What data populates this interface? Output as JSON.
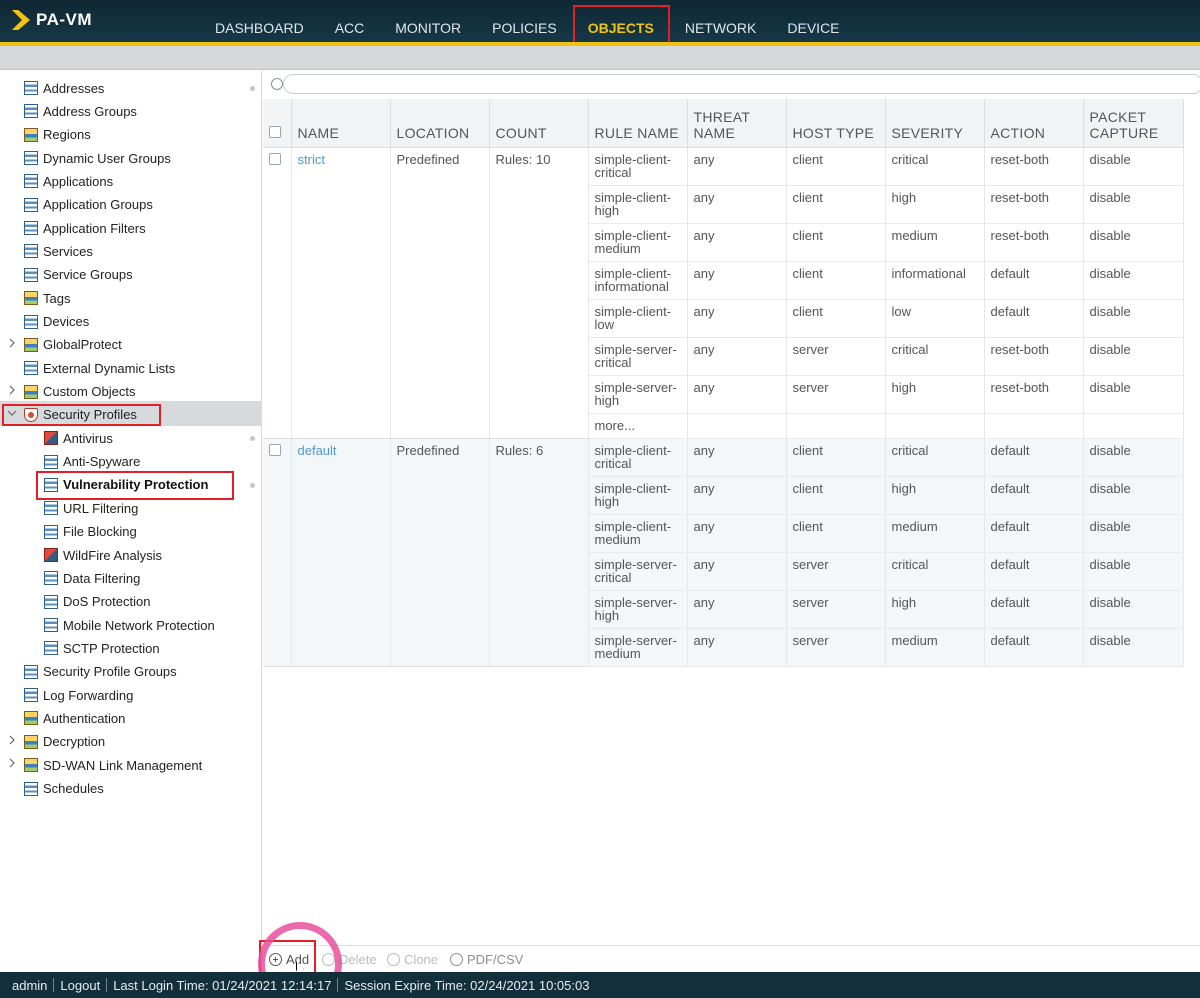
{
  "app": {
    "title": "PA-VM"
  },
  "nav": [
    "DASHBOARD",
    "ACC",
    "MONITOR",
    "POLICIES",
    "OBJECTS",
    "NETWORK",
    "DEVICE"
  ],
  "nav_active": "OBJECTS",
  "sidebar": {
    "items": [
      {
        "label": "Addresses",
        "icon": "address-icon"
      },
      {
        "label": "Address Groups",
        "icon": "address-group-icon"
      },
      {
        "label": "Regions",
        "icon": "region-icon"
      },
      {
        "label": "Dynamic User Groups",
        "icon": "user-group-icon"
      },
      {
        "label": "Applications",
        "icon": "application-icon"
      },
      {
        "label": "Application Groups",
        "icon": "application-group-icon"
      },
      {
        "label": "Application Filters",
        "icon": "application-filter-icon"
      },
      {
        "label": "Services",
        "icon": "service-icon"
      },
      {
        "label": "Service Groups",
        "icon": "service-group-icon"
      },
      {
        "label": "Tags",
        "icon": "tag-icon"
      },
      {
        "label": "Devices",
        "icon": "device-icon"
      },
      {
        "label": "GlobalProtect",
        "icon": "globalprotect-icon"
      },
      {
        "label": "External Dynamic Lists",
        "icon": "external-list-icon"
      },
      {
        "label": "Custom Objects",
        "icon": "custom-object-icon"
      },
      {
        "label": "Security Profiles",
        "icon": "security-profile-icon"
      },
      {
        "label": "Antivirus",
        "icon": "antivirus-icon"
      },
      {
        "label": "Anti-Spyware",
        "icon": "anti-spyware-icon"
      },
      {
        "label": "Vulnerability Protection",
        "icon": "vulnerability-icon"
      },
      {
        "label": "URL Filtering",
        "icon": "url-filter-icon"
      },
      {
        "label": "File Blocking",
        "icon": "file-blocking-icon"
      },
      {
        "label": "WildFire Analysis",
        "icon": "wildfire-icon"
      },
      {
        "label": "Data Filtering",
        "icon": "data-filter-icon"
      },
      {
        "label": "DoS Protection",
        "icon": "dos-icon"
      },
      {
        "label": "Mobile Network Protection",
        "icon": "mobile-network-icon"
      },
      {
        "label": "SCTP Protection",
        "icon": "sctp-icon"
      },
      {
        "label": "Security Profile Groups",
        "icon": "profile-group-icon"
      },
      {
        "label": "Log Forwarding",
        "icon": "log-forwarding-icon"
      },
      {
        "label": "Authentication",
        "icon": "authentication-icon"
      },
      {
        "label": "Decryption",
        "icon": "decryption-icon"
      },
      {
        "label": "SD-WAN Link Management",
        "icon": "sdwan-icon"
      },
      {
        "label": "Schedules",
        "icon": "schedule-icon"
      }
    ],
    "selected": "Vulnerability Protection"
  },
  "search": {
    "placeholder": "",
    "value": ""
  },
  "table": {
    "headers": [
      "NAME",
      "LOCATION",
      "COUNT",
      "RULE NAME",
      "THREAT NAME",
      "HOST TYPE",
      "SEVERITY",
      "ACTION",
      "PACKET CAPTURE"
    ],
    "profiles": [
      {
        "name": "strict",
        "location": "Predefined",
        "count": "Rules: 10",
        "rules": [
          [
            "simple-client-critical",
            "any",
            "client",
            "critical",
            "reset-both",
            "disable"
          ],
          [
            "simple-client-high",
            "any",
            "client",
            "high",
            "reset-both",
            "disable"
          ],
          [
            "simple-client-medium",
            "any",
            "client",
            "medium",
            "reset-both",
            "disable"
          ],
          [
            "simple-client-informational",
            "any",
            "client",
            "informational",
            "default",
            "disable"
          ],
          [
            "simple-client-low",
            "any",
            "client",
            "low",
            "default",
            "disable"
          ],
          [
            "simple-server-critical",
            "any",
            "server",
            "critical",
            "reset-both",
            "disable"
          ],
          [
            "simple-server-high",
            "any",
            "server",
            "high",
            "reset-both",
            "disable"
          ]
        ],
        "more": "more..."
      },
      {
        "name": "default",
        "location": "Predefined",
        "count": "Rules: 6",
        "rules": [
          [
            "simple-client-critical",
            "any",
            "client",
            "critical",
            "default",
            "disable"
          ],
          [
            "simple-client-high",
            "any",
            "client",
            "high",
            "default",
            "disable"
          ],
          [
            "simple-client-medium",
            "any",
            "client",
            "medium",
            "default",
            "disable"
          ],
          [
            "simple-server-critical",
            "any",
            "server",
            "critical",
            "default",
            "disable"
          ],
          [
            "simple-server-high",
            "any",
            "server",
            "high",
            "default",
            "disable"
          ],
          [
            "simple-server-medium",
            "any",
            "server",
            "medium",
            "default",
            "disable"
          ]
        ],
        "more": ""
      }
    ]
  },
  "toolbar": {
    "add": "Add",
    "delete": "Delete",
    "clone": "Clone",
    "export": "PDF/CSV"
  },
  "status": {
    "user": "admin",
    "logout": "Logout",
    "last_login": "Last Login Time: 01/24/2021 12:14:17",
    "session_expire": "Session Expire Time: 02/24/2021 10:05:03"
  },
  "colors": {
    "accent": "#f2c313",
    "header": "#163847",
    "highlight": "#e21f26",
    "link": "#4d9bd1"
  }
}
